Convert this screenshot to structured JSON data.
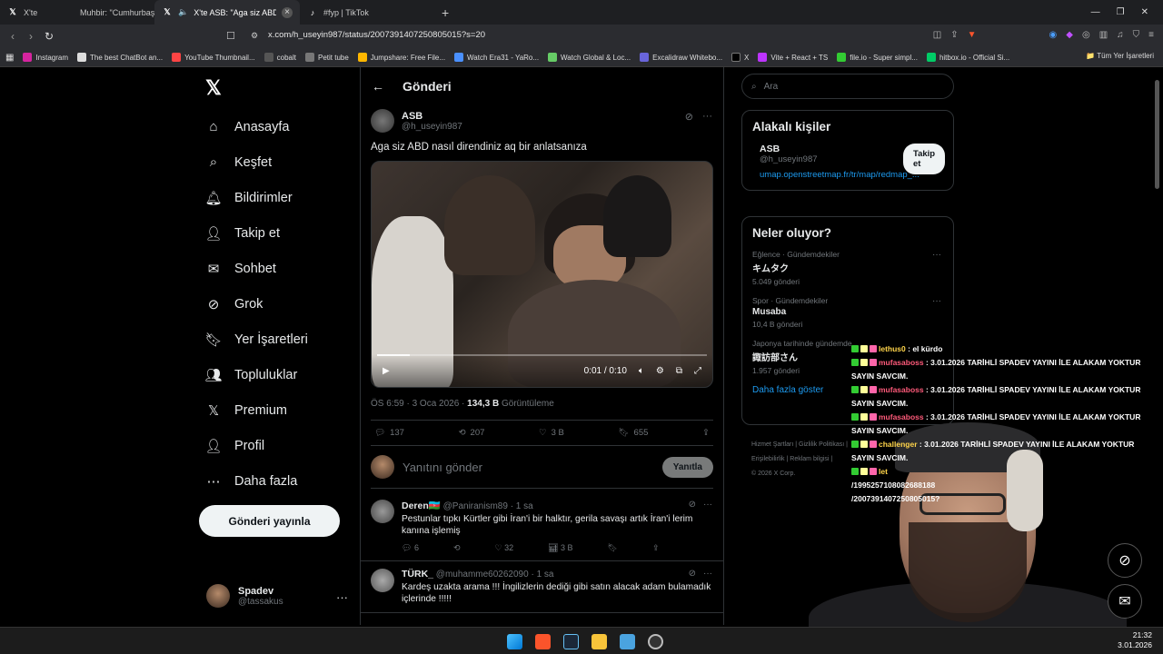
{
  "browser": {
    "tabs": [
      {
        "label": "X'te",
        "extra": "Muhbir: \"Cumhurbaşkanı Ba"
      },
      {
        "label": "X'te ASB: \"Aga siz ABD nasıl d"
      },
      {
        "label": "#fyp | TikTok"
      }
    ],
    "url": "x.com/h_useyin987/status/2007391407250805015?s=20",
    "bookmarks": [
      "Instagram",
      "The best ChatBot an...",
      "YouTube Thumbnail...",
      "cobalt",
      "Petit tube",
      "Jumpshare: Free File...",
      "Watch Era31 - YaRo...",
      "Watch Global & Loc...",
      "Excalidraw Whitebo...",
      "X",
      "Vite + React + TS",
      "file.io - Super simpl...",
      "hitbox.io - Official Si..."
    ],
    "bookmarks_folder": "Tüm Yer İşaretleri"
  },
  "nav": {
    "items": [
      "Anasayfa",
      "Keşfet",
      "Bildirimler",
      "Takip et",
      "Sohbet",
      "Grok",
      "Yer İşaretleri",
      "Topluluklar",
      "Premium",
      "Profil",
      "Daha fazla"
    ],
    "post_button": "Gönderi yayınla",
    "profile_name": "Spadev",
    "profile_handle": "@tassakus"
  },
  "main": {
    "header": "Gönderi",
    "author_name": "ASB",
    "author_handle": "@h_useyin987",
    "text": "Aga siz ABD nasıl direndiniz aq bir anlatsanıza",
    "video_time": "0:01 / 0:10",
    "video_progress": 0.1,
    "time": "ÖS 6:59 · 3 Oca 2026 · ",
    "views": "134,3 B",
    "views_label": " Görüntüleme",
    "stats": {
      "replies": "137",
      "reposts": "207",
      "likes": "3 B",
      "bookmarks": "655"
    },
    "reply_placeholder": "Yanıtını gönder",
    "reply_button": "Yanıtla",
    "replies": [
      {
        "name": "Deren🇦🇿",
        "handle": "@Paniranism89 · 1 sa",
        "text": "Pestunlar tıpkı Kürtler gibi İran'i bir halktır, gerila savaşı artık İran'i lerim kanına işlemiş",
        "r": "6",
        "l": "32",
        "v": "3 B"
      },
      {
        "name": "TÜRK_",
        "handle": "@muhamme60262090 · 1 sa",
        "text": "Kardeş uzakta arama !!! İngilizlerin dediği gibi satın alacak adam bulamadık içlerinde !!!!!",
        "r": "",
        "l": "",
        "v": ""
      }
    ]
  },
  "sidebar": {
    "search_placeholder": "Ara",
    "relevant_title": "Alakalı kişiler",
    "person_name": "ASB",
    "person_handle": "@h_useyin987",
    "person_link": "umap.openstreetmap.fr/tr/map/redmap_...",
    "follow": "Takip et",
    "trends_title": "Neler oluyor?",
    "trends": [
      {
        "cat": "Eğlence · Gündemdekiler",
        "name": "キムタク",
        "posts": "5.049 gönderi"
      },
      {
        "cat": "Spor · Gündemdekiler",
        "name": "Musaba",
        "posts": "10,4 B gönderi"
      },
      {
        "cat": "Japonya tarihinde gündemde",
        "name": "諏訪部さん",
        "posts": "1.957 gönderi"
      }
    ],
    "show_more": "Daha fazla göster",
    "footer_1": "Hizmet Şartları | Gizlilik Politikası |",
    "footer_2": "Erişilebilirlik | Reklam bilgisi |",
    "footer_3": "© 2026 X Corp."
  },
  "chat": [
    {
      "user": "lethus0",
      "msg": " : el kürdo",
      "gold": true
    },
    {
      "user": "mufasaboss",
      "msg": " : 3.01.2026 TARİHLİ SPADEV YAYINI İLE ALAKAM YOKTUR",
      "gold": false
    },
    {
      "user": "",
      "msg": "SAYIN SAVCIM.",
      "gold": false
    },
    {
      "user": "mufasaboss",
      "msg": " : 3.01.2026 TARİHLİ SPADEV YAYINI İLE ALAKAM YOKTUR",
      "gold": false
    },
    {
      "user": "",
      "msg": "SAYIN SAVCIM.",
      "gold": false
    },
    {
      "user": "mufasaboss",
      "msg": " : 3.01.2026 TARİHLİ SPADEV YAYINI İLE ALAKAM YOKTUR",
      "gold": false
    },
    {
      "user": "",
      "msg": "SAYIN SAVCIM.",
      "gold": false
    },
    {
      "user": "challenger",
      "msg": " : 3.01.2026 TARİHLİ SPADEV YAYINI İLE ALAKAM YOKTUR",
      "gold": true
    },
    {
      "user": "",
      "msg": "SAYIN SAVCIM.",
      "gold": false
    },
    {
      "user": "let",
      "msg": "",
      "gold": true
    },
    {
      "user": "",
      "msg": "/1995257108082688188",
      "gold": false
    },
    {
      "user": "",
      "msg": "/2007391407250805015?",
      "gold": false
    }
  ],
  "taskbar": {
    "time": "21:32",
    "date": "3.01.2026"
  },
  "colors": {
    "accent": "#1d9bf0",
    "bg": "#000000",
    "border": "#2f3336",
    "muted": "#71767b"
  }
}
